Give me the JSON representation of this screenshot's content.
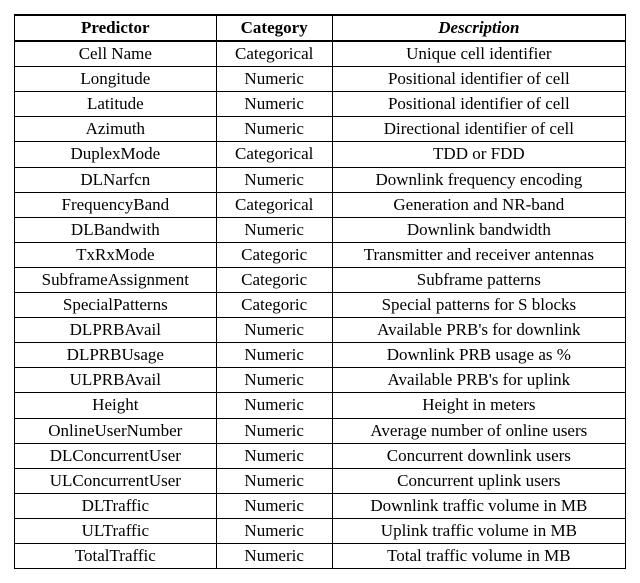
{
  "headers": {
    "predictor": "Predictor",
    "category": "Category",
    "description": "Description"
  },
  "rows": [
    {
      "predictor": "Cell Name",
      "category": "Categorical",
      "description": "Unique cell identifier"
    },
    {
      "predictor": "Longitude",
      "category": "Numeric",
      "description": "Positional identifier of cell"
    },
    {
      "predictor": "Latitude",
      "category": "Numeric",
      "description": "Positional identifier of cell"
    },
    {
      "predictor": "Azimuth",
      "category": "Numeric",
      "description": "Directional identifier of cell"
    },
    {
      "predictor": "DuplexMode",
      "category": "Categorical",
      "description": "TDD or FDD"
    },
    {
      "predictor": "DLNarfcn",
      "category": "Numeric",
      "description": "Downlink frequency encoding"
    },
    {
      "predictor": "FrequencyBand",
      "category": "Categorical",
      "description": "Generation and NR-band"
    },
    {
      "predictor": "DLBandwith",
      "category": "Numeric",
      "description": "Downlink bandwidth"
    },
    {
      "predictor": "TxRxMode",
      "category": "Categoric",
      "description": "Transmitter and receiver antennas"
    },
    {
      "predictor": "SubframeAssignment",
      "category": "Categoric",
      "description": "Subframe patterns"
    },
    {
      "predictor": "SpecialPatterns",
      "category": "Categoric",
      "description": "Special patterns for S blocks"
    },
    {
      "predictor": "DLPRBAvail",
      "category": "Numeric",
      "description": "Available PRB's for downlink"
    },
    {
      "predictor": "DLPRBUsage",
      "category": "Numeric",
      "description": "Downlink PRB usage as %"
    },
    {
      "predictor": "ULPRBAvail",
      "category": "Numeric",
      "description": "Available PRB's for uplink"
    },
    {
      "predictor": "Height",
      "category": "Numeric",
      "description": "Height in meters"
    },
    {
      "predictor": "OnlineUserNumber",
      "category": "Numeric",
      "description": "Average number of online users"
    },
    {
      "predictor": "DLConcurrentUser",
      "category": "Numeric",
      "description": "Concurrent downlink users"
    },
    {
      "predictor": "ULConcurrentUser",
      "category": "Numeric",
      "description": "Concurrent uplink users"
    },
    {
      "predictor": "DLTraffic",
      "category": "Numeric",
      "description": "Downlink traffic volume in MB"
    },
    {
      "predictor": "ULTraffic",
      "category": "Numeric",
      "description": "Uplink traffic volume in MB"
    },
    {
      "predictor": "TotalTraffic",
      "category": "Numeric",
      "description": "Total traffic volume in MB"
    }
  ]
}
